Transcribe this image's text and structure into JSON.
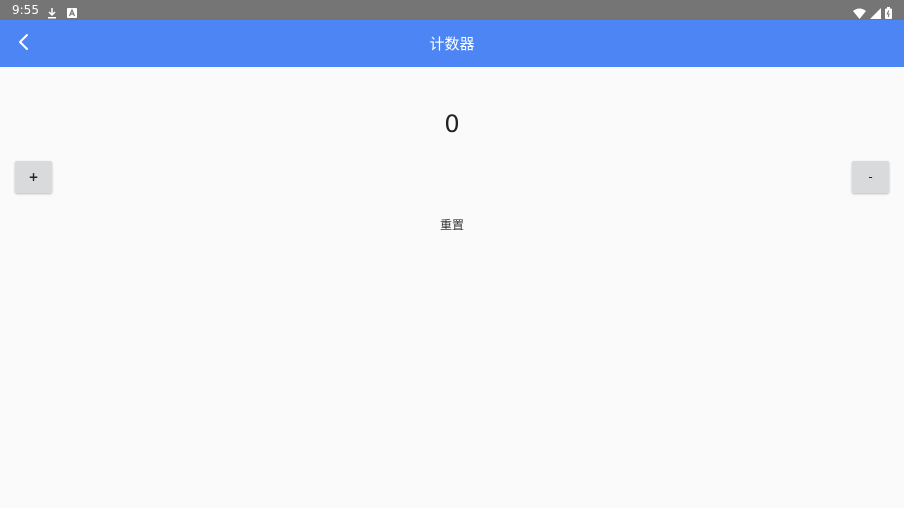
{
  "status_bar": {
    "time": "9:55",
    "icons_left": [
      "download-icon",
      "a-notification-icon"
    ],
    "icons_right": [
      "wifi-icon",
      "cell-signal-icon",
      "battery-icon"
    ]
  },
  "app_bar": {
    "title": "计数器",
    "back_icon": "chevron-left-icon",
    "color": "#4d86f4"
  },
  "counter": {
    "value": "0"
  },
  "buttons": {
    "increment_label": "+",
    "decrement_label": "-",
    "reset_label": "重置"
  }
}
